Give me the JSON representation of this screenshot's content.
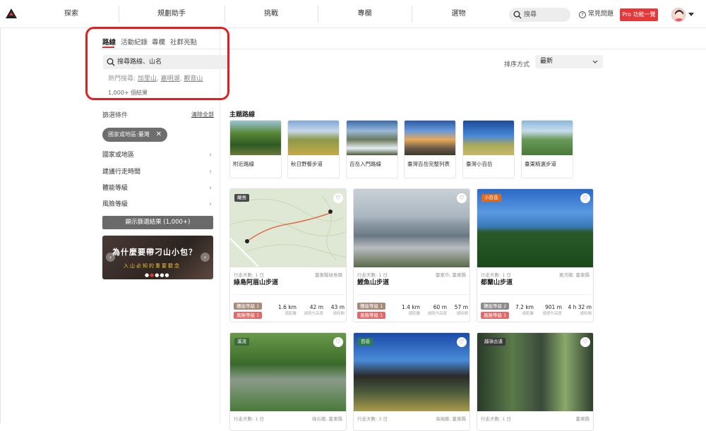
{
  "nav": {
    "items": [
      "探索",
      "規劃助手",
      "挑戰",
      "專欄",
      "選物"
    ],
    "search_placeholder": "搜尋",
    "faq": "常見問題",
    "pro": "Pro 功能一覽"
  },
  "tabs": [
    "路線",
    "活動紀錄",
    "專欄",
    "社群亮點"
  ],
  "search": {
    "placeholder": "搜尋路線、山名",
    "hot_label": "熱門搜尋:",
    "hot": [
      "加里山",
      "嘉明湖",
      "觀音山"
    ],
    "results": "1,000+ 個結果"
  },
  "sort": {
    "label": "排序方式",
    "value": "最新"
  },
  "filters": {
    "title": "篩選條件",
    "clear": "清除全部",
    "chip_label": "國家或地區:",
    "chip_value": "臺灣",
    "rows": [
      "國家或地區",
      "建議行走時間",
      "體能等級",
      "風險等級"
    ],
    "show_button": "顯示篩選結果 (1,000+)"
  },
  "banner": {
    "title": "為什麼要帶刁山小包？",
    "subtitle": "入山必知的重要觀念"
  },
  "themes": {
    "title": "主題路線",
    "items": [
      "附近路線",
      "秋日野餐步道",
      "百岳入門路線",
      "臺灣百岳完整列表",
      "臺灣小百岳",
      "臺東精選步道"
    ]
  },
  "routes": [
    {
      "badge": "離島",
      "badge_color": "#4a4a4a",
      "days": "行走天數: 1 日",
      "loc": "臺東縣綠島鄉",
      "name": "綠島阿眉山步道",
      "fitness": "體能等級 1",
      "risk": "風險等級 1",
      "dist": "1.6 km",
      "dist_lbl": "總距離",
      "gain": "42 m",
      "gain_lbl": "總爬升高度",
      "time": "43 m",
      "time_lbl": "總時間"
    },
    {
      "badge": "",
      "badge_color": "",
      "days": "行走天數: 1 日",
      "loc": "臺東市, 臺東縣",
      "name": "鯉魚山步道",
      "fitness": "體能等級 1",
      "risk": "風險等級 1",
      "dist": "1.4 km",
      "dist_lbl": "總距離",
      "gain": "60 m",
      "gain_lbl": "總爬升高度",
      "time": "57 m",
      "time_lbl": "總時間"
    },
    {
      "badge": "小百岳",
      "badge_color": "#e06a1c",
      "days": "行走天數: 1 日",
      "loc": "東河鄉, 臺東縣",
      "name": "都蘭山步道",
      "fitness": "體能等級 2",
      "risk": "風險等級 1",
      "dist": "7.2 km",
      "dist_lbl": "總距離",
      "gain": "901 m",
      "gain_lbl": "總爬升高度",
      "time": "4 h 32 m",
      "time_lbl": "總時間"
    },
    {
      "badge": "溪流",
      "badge_color": "#3a6a3a",
      "days": "行走天數: 1 日",
      "loc": "綠谷鄉, 臺東縣"
    },
    {
      "badge": "百岳",
      "badge_color": "#2e7d4f",
      "days": "行走天數: 3 日",
      "loc": "海端鄉, 臺東縣"
    },
    {
      "badge": "越嶺古道",
      "badge_color": "#3a3a3a",
      "days": "行走天數: 1 日",
      "loc": "臺東縣"
    }
  ]
}
